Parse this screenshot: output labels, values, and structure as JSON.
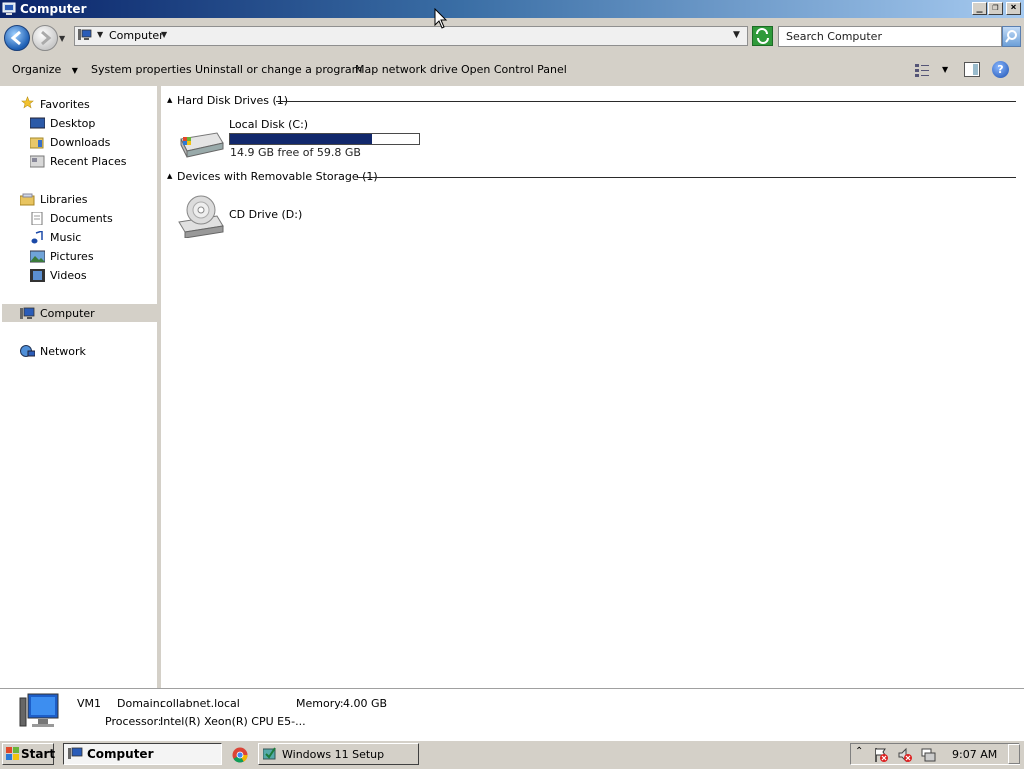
{
  "window": {
    "title": "Computer"
  },
  "address": {
    "path": "Computer",
    "search_placeholder": "Search Computer"
  },
  "commands": {
    "organize": "Organize",
    "system_properties": "System properties",
    "uninstall": "Uninstall or change a program",
    "map_drive": "Map network drive",
    "control_panel": "Open Control Panel"
  },
  "nav": {
    "favorites": "Favorites",
    "desktop": "Desktop",
    "downloads": "Downloads",
    "recent": "Recent Places",
    "libraries": "Libraries",
    "documents": "Documents",
    "music": "Music",
    "pictures": "Pictures",
    "videos": "Videos",
    "computer": "Computer",
    "network": "Network"
  },
  "groups": {
    "hdd": "Hard Disk Drives (1)",
    "removable": "Devices with Removable Storage (1)"
  },
  "drives": {
    "c": {
      "name": "Local Disk (C:)",
      "free": "14.9 GB free of 59.8 GB",
      "used_fraction": 0.75
    },
    "d": {
      "name": "CD Drive (D:)"
    }
  },
  "details": {
    "name": "VM1",
    "domain_label": "Domain:",
    "domain": "collabnet.local",
    "memory_label": "Memory:",
    "memory": "4.00 GB",
    "processor_label": "Processor:",
    "processor": "Intel(R) Xeon(R) CPU E5-..."
  },
  "taskbar": {
    "start": "Start",
    "task_computer": "Computer",
    "task_setup": "Windows 11 Setup",
    "clock": "9:07 AM"
  }
}
